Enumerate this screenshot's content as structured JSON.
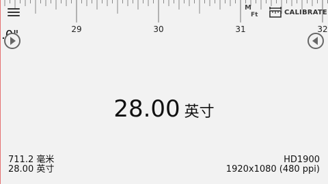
{
  "ruler": {
    "labels": [
      "29",
      "30",
      "31",
      "32"
    ],
    "partial_left_label": ".0\""
  },
  "icons": {
    "menu": "hamburger-menu-icon",
    "unit_toggle": "m-ft-toggle-icon",
    "calibrate": "calibrate-ruler-icon",
    "nav_left": "play-right-icon",
    "nav_right": "play-left-icon"
  },
  "toolbar": {
    "unit_toggle": {
      "m": "M",
      "ft": "Ft"
    },
    "calibrate_label": "CALIBRATE"
  },
  "measurement": {
    "value": "28.00",
    "unit": "英寸"
  },
  "conversions": {
    "mm": "711.2 毫米",
    "inch": "28.00 英寸"
  },
  "device": {
    "model": "HD1900",
    "resolution": "1920x1080 (480 ppi)"
  },
  "colors": {
    "background": "#f2f2f2",
    "ticks": "#888888",
    "left_edge": "#e57373"
  }
}
